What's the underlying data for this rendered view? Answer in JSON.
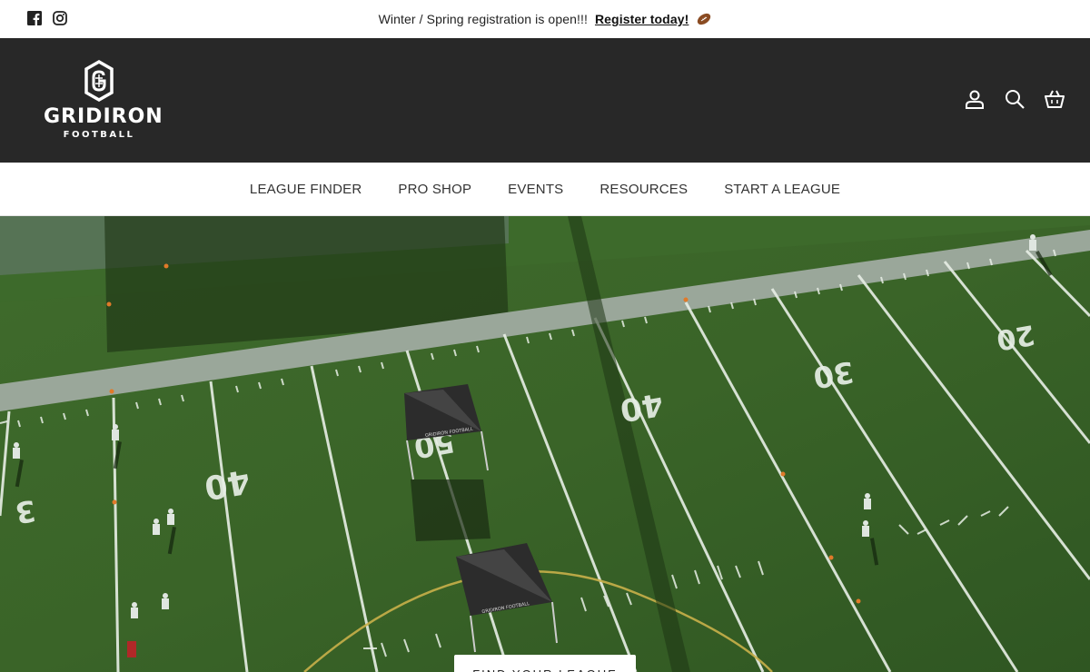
{
  "announcement": {
    "text": "Winter / Spring registration is open!!!",
    "link_label": "Register today!",
    "icons": [
      "facebook-icon",
      "instagram-icon",
      "football-emoji-icon"
    ]
  },
  "header": {
    "logo_word": "GRIDIRON",
    "logo_sub": "FOOTBALL",
    "icons": [
      "account-icon",
      "search-icon",
      "cart-icon"
    ],
    "background": "#282828"
  },
  "nav": {
    "items": [
      {
        "label": "LEAGUE FINDER"
      },
      {
        "label": "PRO SHOP"
      },
      {
        "label": "EVENTS"
      },
      {
        "label": "RESOURCES"
      },
      {
        "label": "START A LEAGUE"
      }
    ]
  },
  "hero": {
    "field_numbers": [
      "20",
      "30",
      "40",
      "50",
      "40",
      "3"
    ],
    "tent_brand": "GRIDIRON FOOTBALL",
    "button_label": "FIND YOUR LEAGUE"
  }
}
